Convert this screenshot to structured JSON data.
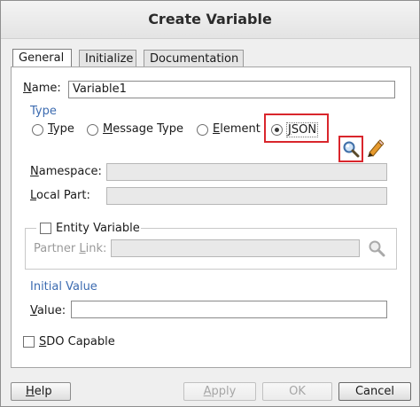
{
  "window": {
    "title": "Create Variable"
  },
  "tabs": [
    {
      "label": "General",
      "active": true
    },
    {
      "label": "Initialize",
      "active": false
    },
    {
      "label": "Documentation",
      "active": false
    }
  ],
  "general": {
    "name_label_mnemonic": "N",
    "name_label_rest": "ame:",
    "name_value": "Variable1",
    "type_section_label": "Type",
    "type_options": [
      {
        "mnemonic": "T",
        "rest": "ype",
        "selected": false
      },
      {
        "mnemonic": "M",
        "rest": "essage Type",
        "selected": false
      },
      {
        "mnemonic": "E",
        "rest": "lement",
        "selected": false
      },
      {
        "mnemonic": "J",
        "rest": "SON",
        "selected": true
      }
    ],
    "search_icon": "magnifier-icon",
    "edit_icon": "pencil-icon",
    "namespace_label_mnemonic": "N",
    "namespace_label_rest": "amespace:",
    "namespace_value": "",
    "localpart_label_mnemonic": "L",
    "localpart_label_rest": "ocal Part:",
    "localpart_value": "",
    "entity_variable_label": "Entity Variable",
    "entity_variable_checked": false,
    "partner_link_label_pre": "Partner ",
    "partner_link_label_mnemonic": "L",
    "partner_link_label_rest": "ink:",
    "partner_link_value": "",
    "initial_value_section_label": "Initial Value",
    "value_label_mnemonic": "V",
    "value_label_rest": "alue:",
    "value_value": "",
    "sdo_label_mnemonic": "S",
    "sdo_label_rest": "DO Capable",
    "sdo_checked": false
  },
  "buttons": {
    "help_mnemonic": "H",
    "help_rest": "elp",
    "apply_mnemonic": "A",
    "apply_rest": "pply",
    "ok_label": "OK",
    "cancel_label": "Cancel"
  },
  "colors": {
    "section_label": "#3c6bb0",
    "highlight": "#d9262c"
  }
}
